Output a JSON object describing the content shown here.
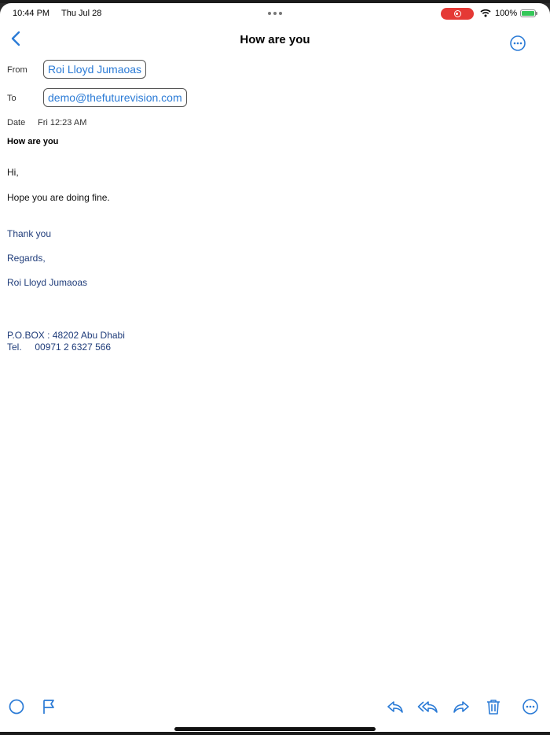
{
  "status_bar": {
    "time": "10:44 PM",
    "date": "Thu Jul 28",
    "battery_percent": "100%",
    "icons": [
      "screen-record-icon",
      "wifi-icon",
      "battery-icon"
    ]
  },
  "nav": {
    "title": "How are you",
    "back_icon": "chevron-left-icon",
    "more_icon": "ellipsis-circle-icon"
  },
  "message": {
    "from_label": "From",
    "from_value": "Roi Lloyd Jumaoas",
    "to_label": "To",
    "to_value": "demo@thefuturevision.com",
    "date_label": "Date",
    "date_value": "Fri 12:23 AM",
    "subject": "How are you",
    "body": {
      "greeting": "Hi,",
      "line1": "Hope you are doing fine.",
      "thanks": "Thank you",
      "regards": "Regards,",
      "name": "Roi Lloyd Jumaoas",
      "po_box": "P.O.BOX : 48202 Abu Dhabi",
      "tel": "Tel.     00971 2 6327 566"
    }
  },
  "toolbar": {
    "icons": [
      "mark-unread-icon",
      "flag-icon",
      "reply-icon",
      "reply-all-icon",
      "forward-icon",
      "trash-icon",
      "more-icon"
    ]
  },
  "colors": {
    "accent": "#2b7bd6",
    "body_signature": "#1f3c7a",
    "record_badge": "#e53935",
    "battery": "#35c759"
  }
}
